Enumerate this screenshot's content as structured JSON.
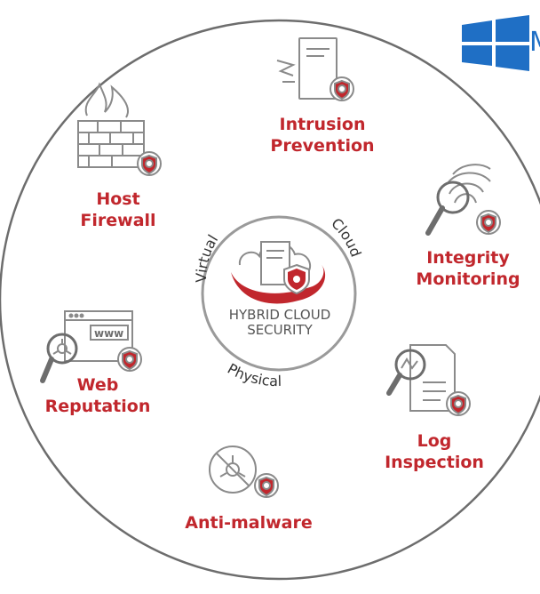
{
  "colors": {
    "accent": "#c1272d",
    "icon_gray": "#8a8a8a",
    "ring": "#9a9a9a",
    "brand_blue": "#1f6fc5"
  },
  "brand": {
    "logo_icon": "windows-logo-icon",
    "text": "M"
  },
  "hub": {
    "icon": "cloud-server-shield-icon",
    "label_line1": "HYBRID CLOUD",
    "label_line2": "SECURITY",
    "arc_labels": {
      "virtual": "Virtual",
      "cloud": "Cloud",
      "physical": "Physical"
    }
  },
  "modules": {
    "intrusion_prevention": {
      "line1": "Intrusion",
      "line2": "Prevention",
      "icon": "server-shield-icon"
    },
    "host_firewall": {
      "line1": "Host",
      "line2": "Firewall",
      "icon": "firewall-shield-icon"
    },
    "integrity_monitoring": {
      "line1": "Integrity",
      "line2": "Monitoring",
      "icon": "fingerprint-magnifier-icon"
    },
    "web_reputation": {
      "line1": "Web",
      "line2": "Reputation",
      "icon": "web-biohazard-icon",
      "browser_text": "www"
    },
    "log_inspection": {
      "line1": "Log",
      "line2": "Inspection",
      "icon": "log-magnifier-icon"
    },
    "anti_malware": {
      "line1": "Anti-malware",
      "icon": "anti-malware-icon"
    }
  }
}
